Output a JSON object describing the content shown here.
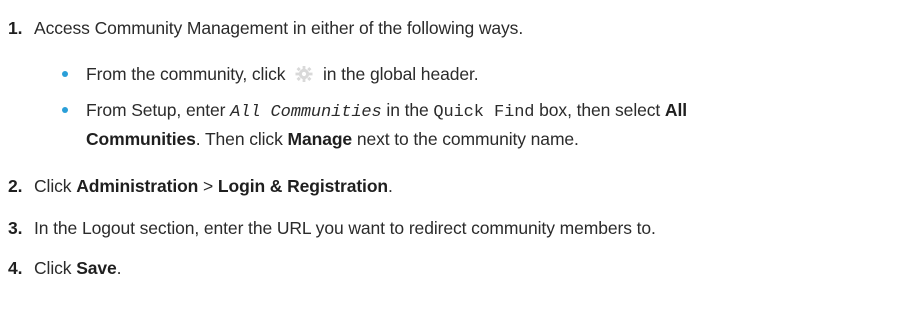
{
  "steps": [
    {
      "num": "1.",
      "text": "Access Community Management in either of the following ways."
    },
    {
      "num": "2.",
      "pre": "Click ",
      "bold1": "Administration",
      "mid": " > ",
      "bold2": "Login & Registration",
      "post": "."
    },
    {
      "num": "3.",
      "text": "In the Logout section, enter the URL you want to redirect community members to."
    },
    {
      "num": "4.",
      "pre": "Click ",
      "bold1": "Save",
      "post": "."
    }
  ],
  "substeps": [
    {
      "pre": "From the community, click",
      "icon": "gear-icon",
      "post": "in the global header."
    },
    {
      "t1": "From Setup, enter ",
      "code1": "All Communities",
      "t2": " in the ",
      "code2": "Quick Find",
      "t3": " box, then select ",
      "b1": "All",
      "b1cont": "Communities",
      "t4": ". Then click ",
      "b2": "Manage",
      "t5": " next to the community name."
    }
  ],
  "colors": {
    "bullet": "#2a9fd8",
    "icon": "#d8d8d8"
  }
}
